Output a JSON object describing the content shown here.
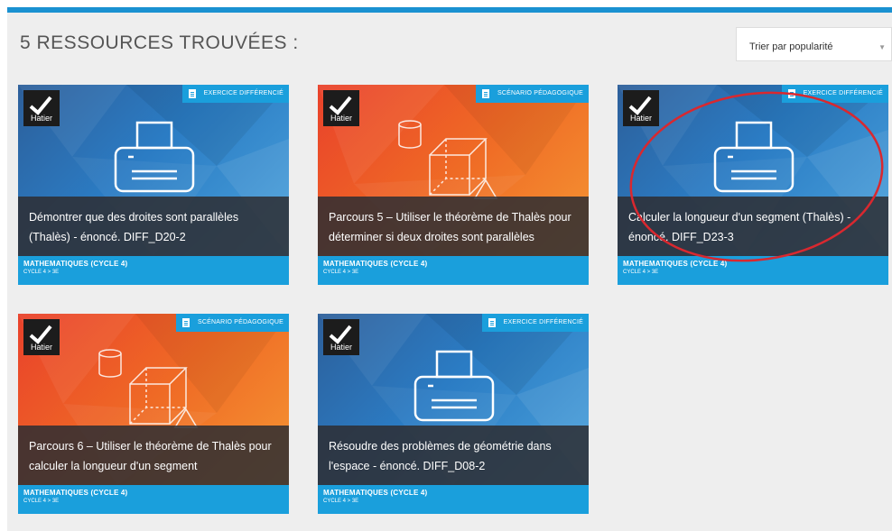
{
  "header": {
    "results_title": "5 RESSOURCES TROUVÉES :"
  },
  "sort": {
    "label": "Trier par popularité"
  },
  "brand": {
    "name": "Hatier"
  },
  "colors": {
    "accent": "#1a9fdc",
    "topbar": "#1a91d1",
    "title_overlay": "#2d2d32"
  },
  "cards": [
    {
      "type": "EXERCICE DIFFÉRENCIÉ",
      "title": "Démontrer que des droites sont parallèles (Thalès) - énoncé. DIFF_D20-2",
      "subject": "MATHEMATIQUES (CYCLE 4)",
      "level": "CYCLE 4 > 3E",
      "theme": "blue",
      "icon": "printer-icon"
    },
    {
      "type": "SCÉNARIO PÉDAGOGIQUE",
      "title": "Parcours 5 – Utiliser le théorème de Thalès pour déterminer si deux droites sont parallèles",
      "subject": "MATHEMATIQUES (CYCLE 4)",
      "level": "CYCLE 4 > 3E",
      "theme": "orange",
      "icon": "geometry-shapes-icon"
    },
    {
      "type": "EXERCICE DIFFÉRENCIÉ",
      "title": "Calculer la longueur d'un segment (Thalès) - énoncé. DIFF_D23-3",
      "subject": "MATHEMATIQUES (CYCLE 4)",
      "level": "CYCLE 4 > 3E",
      "theme": "blue",
      "icon": "printer-icon"
    },
    {
      "type": "SCÉNARIO PÉDAGOGIQUE",
      "title": "Parcours 6 – Utiliser le théorème de Thalès pour calculer la longueur d'un segment",
      "subject": "MATHEMATIQUES (CYCLE 4)",
      "level": "CYCLE 4 > 3E",
      "theme": "orange",
      "icon": "geometry-shapes-icon"
    },
    {
      "type": "EXERCICE DIFFÉRENCIÉ",
      "title": "Résoudre des problèmes de géométrie dans l'espace - énoncé. DIFF_D08-2",
      "subject": "MATHEMATIQUES (CYCLE 4)",
      "level": "CYCLE 4 > 3E",
      "theme": "blue",
      "icon": "printer-icon"
    }
  ]
}
